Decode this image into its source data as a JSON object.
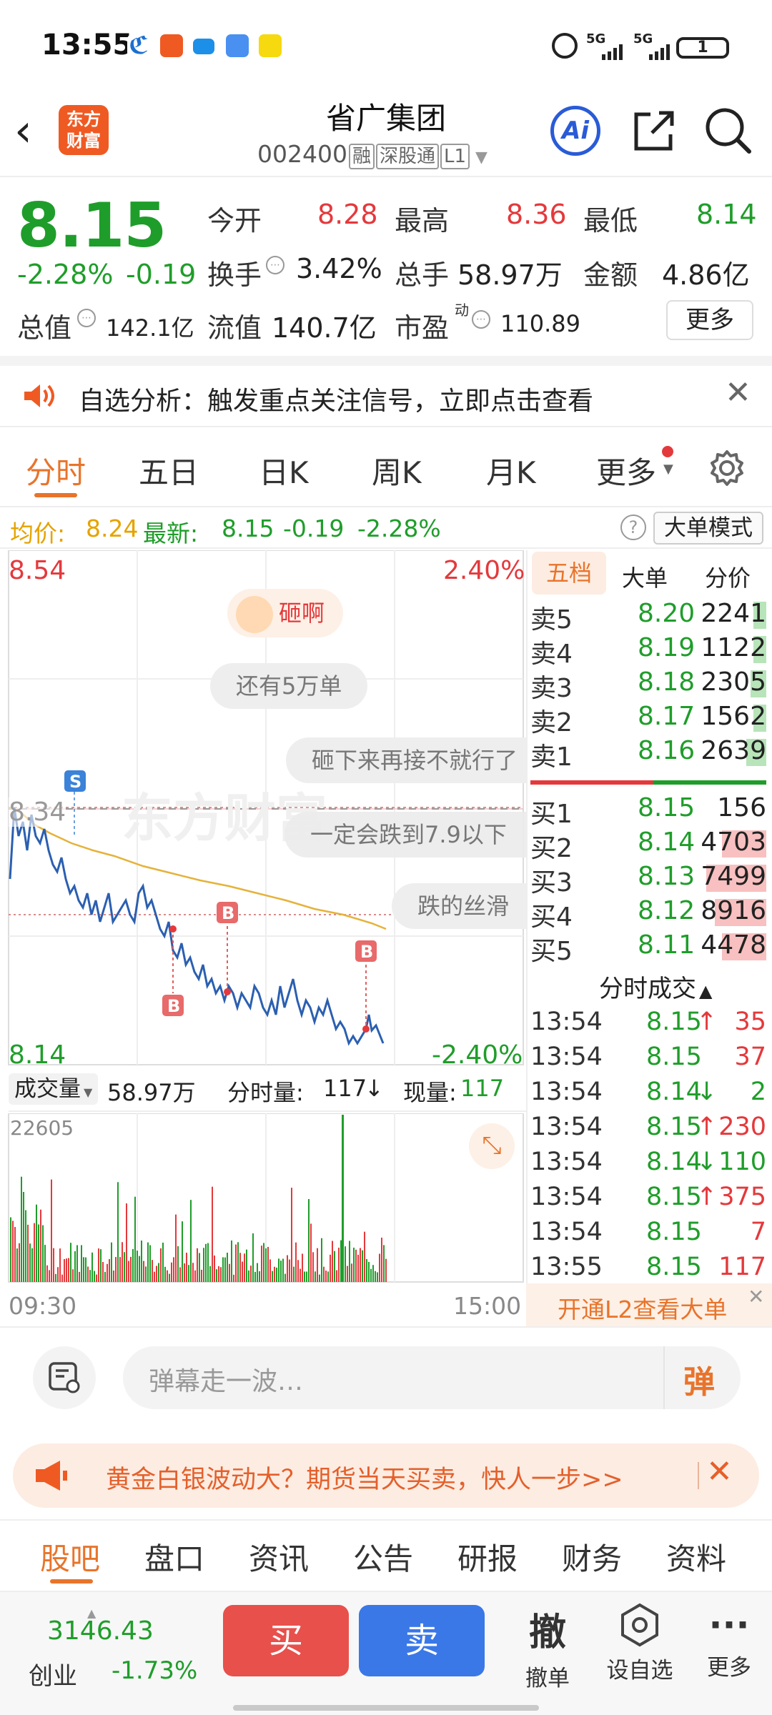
{
  "status_bar": {
    "time": "13:55",
    "network1": "5G",
    "network2": "5G",
    "battery": "1"
  },
  "header": {
    "logo_text": "东方财富",
    "stock_name": "省广集团",
    "stock_code": "002400",
    "tags": [
      "融",
      "深股通",
      "L1"
    ]
  },
  "quote": {
    "price": "8.15",
    "change_pct": "-2.28%",
    "change": "-0.19",
    "open_label": "今开",
    "open": "8.28",
    "high_label": "最高",
    "high": "8.36",
    "low_label": "最低",
    "low": "8.14",
    "turnover_label": "换手",
    "turnover": "3.42%",
    "volume_label": "总手",
    "volume": "58.97万",
    "amount_label": "金额",
    "amount": "4.86亿",
    "mcap_label": "总值",
    "mcap": "142.1亿",
    "float_label": "流值",
    "float_mcap": "140.7亿",
    "pe_label": "市盈",
    "pe_sup": "动",
    "pe": "110.89",
    "more_button": "更多"
  },
  "notice": {
    "text": "自选分析：触发重点关注信号，立即点击查看"
  },
  "chart_tabs": [
    "分时",
    "五日",
    "日K",
    "周K",
    "月K",
    "更多"
  ],
  "info_row": {
    "avg_label": "均价:",
    "avg": "8.24",
    "latest_label": "最新:",
    "latest": "8.15",
    "latest_change": "-0.19",
    "latest_pct": "-2.28%",
    "big_order_mode": "大单模式"
  },
  "intraday": {
    "max_price": "8.54",
    "max_pct": "2.40%",
    "min_price": "8.14",
    "min_pct": "-2.40%",
    "ref_price": "8.34",
    "watermark": "东方财富",
    "comments": [
      "砸啊",
      "还有5万单",
      "砸下来再接不就行了",
      "一定会跌到7.9以下",
      "跌的丝滑"
    ],
    "markers": [
      "S",
      "B",
      "B",
      "B"
    ]
  },
  "volume_panel": {
    "label": "成交量",
    "total": "58.97万",
    "minute_label": "分时量:",
    "minute_vol": "117",
    "current_label": "现量:",
    "current_vol": "117",
    "max_vol": "22605",
    "time_start": "09:30",
    "time_end": "15:00"
  },
  "order_book": {
    "tabs": [
      "五档",
      "大单",
      "分价"
    ],
    "asks": [
      {
        "label": "卖5",
        "price": "8.20",
        "vol": "2241"
      },
      {
        "label": "卖4",
        "price": "8.19",
        "vol": "1122"
      },
      {
        "label": "卖3",
        "price": "8.18",
        "vol": "2305"
      },
      {
        "label": "卖2",
        "price": "8.17",
        "vol": "1562"
      },
      {
        "label": "卖1",
        "price": "8.16",
        "vol": "2639"
      }
    ],
    "bids": [
      {
        "label": "买1",
        "price": "8.15",
        "vol": "156"
      },
      {
        "label": "买2",
        "price": "8.14",
        "vol": "4703"
      },
      {
        "label": "买3",
        "price": "8.13",
        "vol": "7499"
      },
      {
        "label": "买4",
        "price": "8.12",
        "vol": "8916"
      },
      {
        "label": "买5",
        "price": "8.11",
        "vol": "4478"
      }
    ],
    "trades_title": "分时成交",
    "trades": [
      {
        "time": "13:54",
        "price": "8.15",
        "arrow": "↑",
        "vol": "35"
      },
      {
        "time": "13:54",
        "price": "8.15",
        "arrow": "",
        "vol": "37"
      },
      {
        "time": "13:54",
        "price": "8.14",
        "arrow": "↓",
        "vol": "2"
      },
      {
        "time": "13:54",
        "price": "8.15",
        "arrow": "↑",
        "vol": "230"
      },
      {
        "time": "13:54",
        "price": "8.14",
        "arrow": "↓",
        "vol": "110"
      },
      {
        "time": "13:54",
        "price": "8.15",
        "arrow": "↑",
        "vol": "375"
      },
      {
        "time": "13:54",
        "price": "8.15",
        "arrow": "",
        "vol": "7"
      },
      {
        "time": "13:55",
        "price": "8.15",
        "arrow": "",
        "vol": "117"
      }
    ],
    "l2_banner": "开通L2查看大单"
  },
  "danmaku": {
    "placeholder": "弹幕走一波…",
    "send_label": "弹"
  },
  "ad": {
    "text": "黄金白银波动大？期货当天买卖，快人一步>>"
  },
  "bottom_tabs": [
    "股吧",
    "盘口",
    "资讯",
    "公告",
    "研报",
    "财务",
    "资料"
  ],
  "action_bar": {
    "index_value": "3146.43",
    "index_name": "创业",
    "index_pct": "-1.73%",
    "buy": "买",
    "sell": "卖",
    "cancel_glyph": "撤",
    "cancel_label": "撤单",
    "watch_label": "设自选",
    "more_label": "更多"
  },
  "colors": {
    "up": "#e4393c",
    "down": "#1f9d2a",
    "accent": "#ef5a23",
    "price_line": "#2b5fb0",
    "avg_line": "#e5b23a"
  }
}
